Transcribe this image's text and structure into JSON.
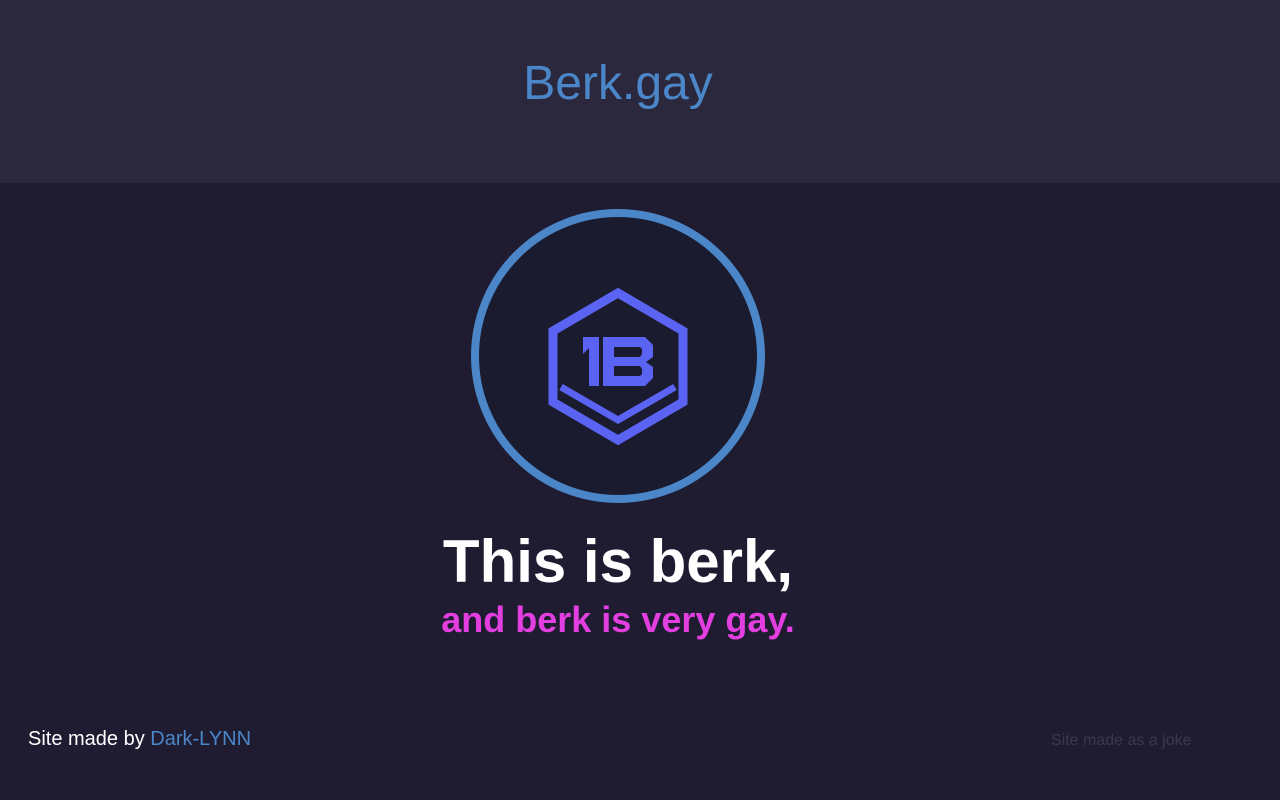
{
  "header": {
    "title": "Berk.gay"
  },
  "main": {
    "logo_icon": "berk-hexagon-b-logo-icon",
    "headline": "This is berk,",
    "subline": "and berk is very gay."
  },
  "footer": {
    "credit_prefix": "Site made by",
    "credit_link": "Dark-LYNN",
    "note": "Site made as a joke"
  },
  "colors": {
    "header_bg": "#2b283e",
    "page_bg": "#1f1c32",
    "accent_blue": "#4a86c8",
    "logo_purple": "#5b63f2",
    "subline_pink": "#e23ee0"
  }
}
